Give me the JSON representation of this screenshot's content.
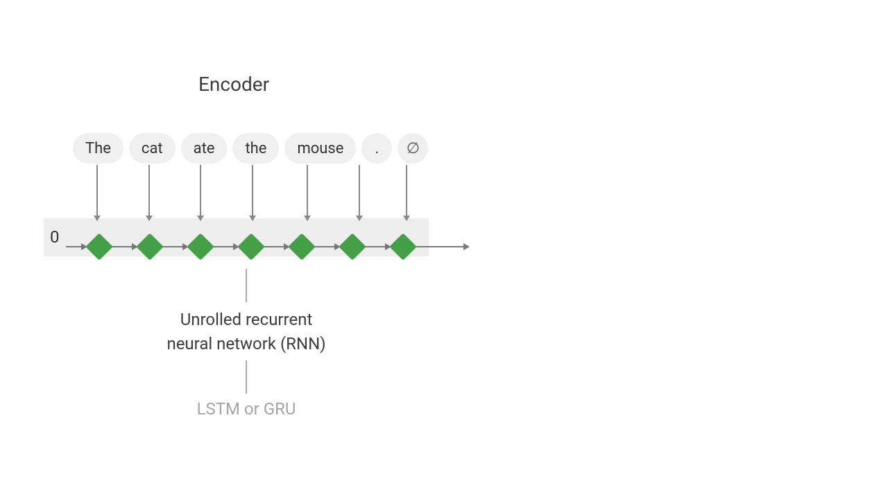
{
  "title": "Encoder",
  "initial_state": "0",
  "tokens": [
    "The",
    "cat",
    "ate",
    "the",
    "mouse",
    ".",
    "∅"
  ],
  "caption_main": "Unrolled recurrent neural network (RNN)",
  "caption_sub": "LSTM or GRU",
  "colors": {
    "node": "#43a047",
    "strip": "#eeeeee",
    "token_bg": "#f0f0f0",
    "text": "#3c3c3c",
    "subtext": "#a5a5a5",
    "arrow": "#777777"
  }
}
